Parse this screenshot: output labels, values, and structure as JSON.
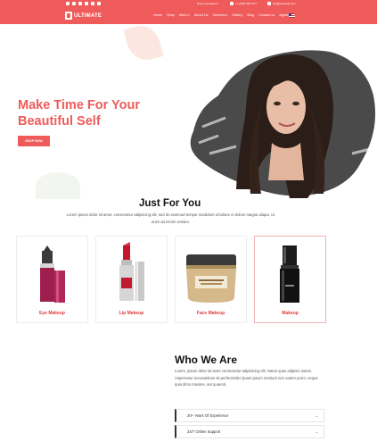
{
  "topbar": {
    "support_label": "Need a question?",
    "phone": "+1 (555) 555 0177",
    "email": "info@example.com"
  },
  "brand": {
    "logo_text": "ULTIMATE"
  },
  "menu": [
    {
      "label": "Home",
      "dropdown": false
    },
    {
      "label": "Shop",
      "dropdown": false
    },
    {
      "label": "Menu",
      "dropdown": true
    },
    {
      "label": "About Us",
      "dropdown": false
    },
    {
      "label": "Services",
      "dropdown": true
    },
    {
      "label": "Gallery",
      "dropdown": false
    },
    {
      "label": "Blog",
      "dropdown": false
    },
    {
      "label": "Contact us",
      "dropdown": false
    },
    {
      "label": "Agents",
      "dropdown": false
    }
  ],
  "hero": {
    "title": "Make Time For Your Beautiful Self",
    "button": "SHOP NOW"
  },
  "just_for_you": {
    "title": "Just For You",
    "description": "Lorem ipsum dolor sit amet, consectetur adipiscing elit, sed do eiusmod tempor incididunt ut labore et dolore magna aliqua. Ut enim ad minim veniam.",
    "cards": [
      {
        "label": "Eye Makeup",
        "icon": "eyeliner-pencil-icon"
      },
      {
        "label": "Lip Makeup",
        "icon": "lipstick-icon"
      },
      {
        "label": "Face Makeup",
        "icon": "face-cream-jar-icon"
      },
      {
        "label": "Makeup",
        "icon": "foundation-bottle-icon"
      }
    ]
  },
  "who_we_are": {
    "title": "Who We Are",
    "text": "Lorem, ipsum dolor sit amet consectetur adipisicing elit. Natus quas adipisci autem. Aspernatur accusantium sit perferendis! Quam ipsum nostrum iure autem porro, neque quia dicta maxime, aut quaerat.",
    "accordion": [
      {
        "label": "20+ Years Of Experience"
      },
      {
        "label": "24/7 Online Support"
      }
    ]
  },
  "colors": {
    "accent": "#ef5b5b",
    "text": "#222222"
  }
}
